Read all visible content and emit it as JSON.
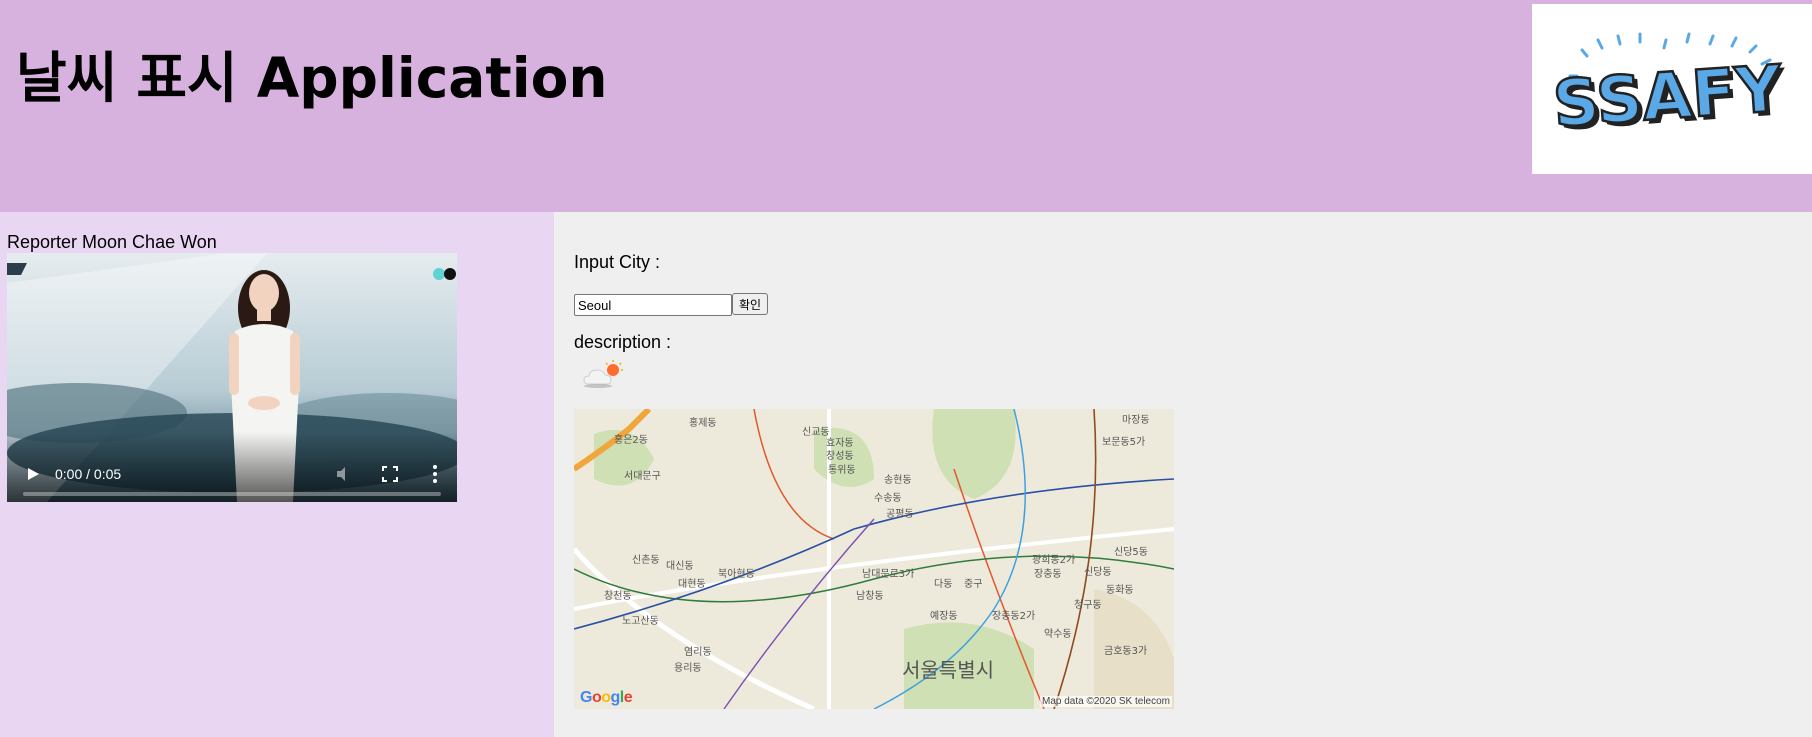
{
  "header": {
    "title": "날씨 표시 Application",
    "logo": {
      "text": "SSAFY",
      "icon": "ssafy-logo-icon",
      "color": "#5aa9e6"
    },
    "background": "#d8b2df"
  },
  "sidebar": {
    "reporter_label": "Reporter Moon Chae Won",
    "video": {
      "time_display": "0:00 / 0:05",
      "progress": 0
    },
    "background": "#e8d6f2"
  },
  "main": {
    "input_city_label": "Input City :",
    "city_input_value": "Seoul",
    "confirm_button_label": "확인",
    "description_label": "description :",
    "weather_icon": "cloud-sun-icon",
    "map": {
      "city_label": "서울특별시",
      "attribution": "Map data ©2020 SK telecom",
      "google_text": "Google",
      "district_labels": [
        "홍제동",
        "홍은2동",
        "서대문구",
        "신교동",
        "효자동",
        "창성동",
        "통위동",
        "송현동",
        "수송동",
        "공평동",
        "신촌동",
        "대신동",
        "북아현동",
        "대현동",
        "창천동",
        "노고산동",
        "염리동",
        "용리동",
        "남대문로3가",
        "남창동",
        "다동",
        "중구",
        "예장동",
        "장충동2가",
        "광희동2가",
        "장충동",
        "신당동",
        "신당5동",
        "동화동",
        "청구동",
        "약수동",
        "금호동3가",
        "마장동",
        "보문동5가"
      ]
    }
  }
}
